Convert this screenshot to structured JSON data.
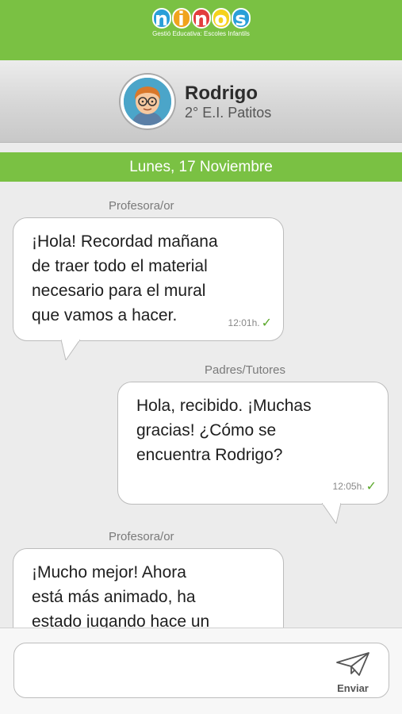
{
  "brand": {
    "logo_text": [
      "n",
      "i",
      "n",
      "o",
      "s"
    ],
    "logo_colors": [
      "#2a9fd8",
      "#f0a31c",
      "#e23d3d",
      "#f5d21c",
      "#2a9fd8"
    ],
    "tagline": "Gestió Educativa: Escoles Infantils"
  },
  "profile": {
    "name": "Rodrigo",
    "class": "2° E.I. Patitos"
  },
  "date_header": "Lunes, 17 Noviembre",
  "messages": [
    {
      "sender": "Profesora/or",
      "text": "¡Hola! Recordad mañana\nde traer todo el material\nnecesario para el mural\nque vamos a hacer.",
      "time": "12:01h.",
      "status_icon": "check-icon"
    },
    {
      "sender": "Padres/Tutores",
      "text": "Hola, recibido. ¡Muchas\ngracias! ¿Cómo se\nencuentra Rodrigo?",
      "time": "12:05h.",
      "status_icon": "check-icon"
    },
    {
      "sender": "Profesora/or",
      "text": "¡Mucho mejor! Ahora\nestá más animado, ha\nestado jugando hace un",
      "time": "",
      "status_icon": ""
    }
  ],
  "composer": {
    "placeholder": "",
    "send_label": "Enviar",
    "send_icon": "paper-plane-icon"
  },
  "colors": {
    "accent_green": "#7ac143",
    "check_green": "#5aa82a"
  }
}
